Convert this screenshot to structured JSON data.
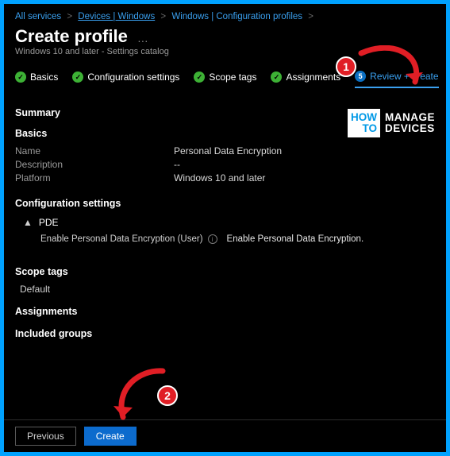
{
  "breadcrumb": {
    "items": [
      "All services",
      "Devices | Windows",
      "Windows | Configuration profiles"
    ]
  },
  "header": {
    "title": "Create profile",
    "subtitle": "Windows 10 and later - Settings catalog"
  },
  "tabs": {
    "items": [
      {
        "label": "Basics",
        "done": true
      },
      {
        "label": "Configuration settings",
        "done": true
      },
      {
        "label": "Scope tags",
        "done": true
      },
      {
        "label": "Assignments",
        "done": true
      },
      {
        "label": "Review + create",
        "done": false,
        "current": true,
        "step": "5"
      }
    ]
  },
  "summary": {
    "heading": "Summary",
    "basics": {
      "heading": "Basics",
      "name_label": "Name",
      "name_value": "Personal Data Encryption",
      "description_label": "Description",
      "description_value": "--",
      "platform_label": "Platform",
      "platform_value": "Windows 10 and later"
    },
    "config": {
      "heading": "Configuration settings",
      "group_name": "PDE",
      "setting_label": "Enable Personal Data Encryption (User)",
      "setting_value": "Enable Personal Data Encryption."
    },
    "scope": {
      "heading": "Scope tags",
      "value": "Default"
    },
    "assignments": {
      "heading": "Assignments",
      "included_heading": "Included groups"
    }
  },
  "footer": {
    "previous": "Previous",
    "create": "Create"
  },
  "annotations": {
    "badge1": "1",
    "badge2": "2"
  },
  "watermark": {
    "left_top": "HOW",
    "left_bottom": "TO",
    "right_top": "MANAGE",
    "right_bottom": "DEVICES"
  }
}
